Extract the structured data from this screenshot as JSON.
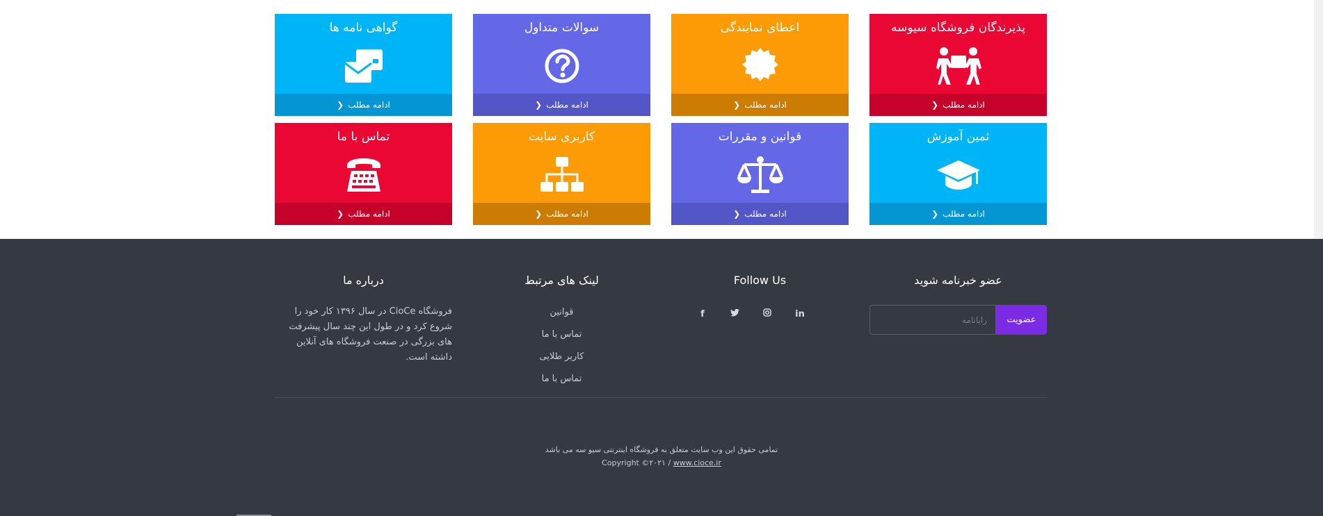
{
  "cards": [
    {
      "title": "پذیرندگان فروشگاه سیوسه",
      "more": "ادامه مطلب",
      "icon": "people-carry-icon",
      "color": "#ea0734"
    },
    {
      "title": "اعطای نمایندگی",
      "more": "ادامه مطلب",
      "icon": "certificate-badge-icon",
      "color": "#fd9b06"
    },
    {
      "title": "سوالات متداول",
      "more": "ادامه مطلب",
      "icon": "question-circle-icon",
      "color": "#6568e6"
    },
    {
      "title": "گواهی نامه ها",
      "more": "ادامه مطلب",
      "icon": "envelopes-icon",
      "color": "#00b4f8"
    },
    {
      "title": "ثمین آموزش",
      "more": "ادامه مطلب",
      "icon": "graduation-cap-icon",
      "color": "#00b4f8"
    },
    {
      "title": "قوانین و مقررات",
      "more": "ادامه مطلب",
      "icon": "balance-scale-icon",
      "color": "#6568e6"
    },
    {
      "title": "کاربری سایت",
      "more": "ادامه مطلب",
      "icon": "sitemap-icon",
      "color": "#fd9b06"
    },
    {
      "title": "تماس با ما",
      "more": "ادامه مطلب",
      "icon": "telephone-icon",
      "color": "#ea0734"
    }
  ],
  "footer": {
    "newsletter": {
      "title": "عضو خبرنامه شوید",
      "placeholder": "رایانامه",
      "button": "عضویت"
    },
    "follow": {
      "title": "Follow Us",
      "icons": [
        "linkedin-icon",
        "instagram-icon",
        "twitter-icon",
        "facebook-icon"
      ]
    },
    "links": {
      "title": "لینک های مرتبط",
      "items": [
        "قوانین",
        "تماس با ما",
        "کاربر طلایی",
        "تماس با ما"
      ]
    },
    "about": {
      "title": "درباره ما",
      "text": "فروشگاه CioCe در سال ۱۳۹۶ کار خود را شروع کرد و در طول این چند سال پیشرفت های بزرگی در صنعت فروشگاه های آنلاین داشته است."
    },
    "copyright_line1": "تمامی حقوق این وب سایت متعلق به فروشگاه اینترنتی سیو سه می باشد",
    "copyright_prefix": "Copyright ©۲۰۲۱ / ",
    "copyright_link": "www.cioce.ir"
  },
  "colors": {
    "footer_bg": "#353940",
    "accent": "#7b2be3"
  }
}
